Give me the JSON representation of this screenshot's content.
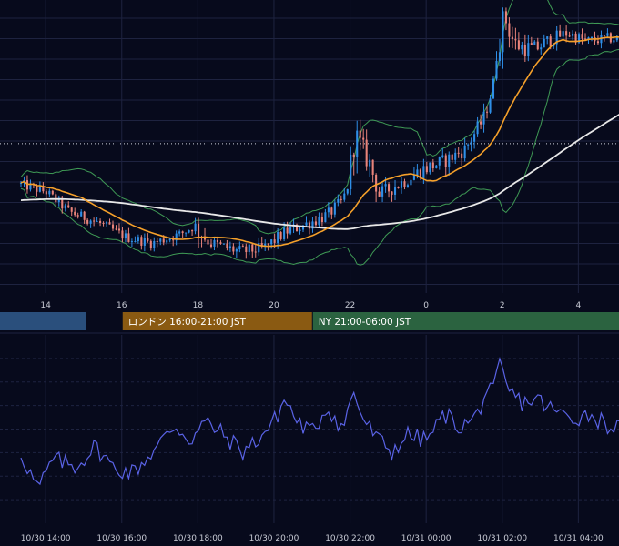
{
  "colors": {
    "background": "#070a1c",
    "grid": "#1e2340",
    "bull": "#2f8fe8",
    "bear": "#e8837a",
    "bollinger": "#3f9a55",
    "sma_short": "#f5a02a",
    "sma_long": "#e8e8e8",
    "rsi": "#5a63e6",
    "tokyo": "#2a4f7c",
    "london": "#8a5a12",
    "newyork": "#2b6340"
  },
  "sessions": [
    {
      "label": "",
      "start_h": 0,
      "end_h": 19.88
    },
    {
      "label": "ロンドン 16:00-21:00 JST",
      "start_h": 16,
      "end_h": 21
    },
    {
      "label": "NY 21:00-06:00 JST",
      "start_h": 21,
      "end_h": 31
    }
  ],
  "top_axis_ticks": [
    "14",
    "16",
    "18",
    "20",
    "22",
    "0",
    "2",
    "4"
  ],
  "bottom_axis_ticks": [
    "10/30 14:00",
    "10/30 16:00",
    "10/30 18:00",
    "10/30 20:00",
    "10/30 22:00",
    "10/31 00:00",
    "10/31 02:00",
    "10/31 04:00"
  ],
  "chart_data": [
    {
      "type": "candlestick",
      "x_start_h": 13.35,
      "x_end_h": 29.5,
      "interval_min": 5,
      "ylim": [
        0,
        100
      ],
      "x_ticks_h": [
        14,
        16,
        18,
        20,
        22,
        24,
        26,
        28
      ],
      "grid": true,
      "reference_level": 51,
      "anchors": [
        [
          13.35,
          37
        ],
        [
          14.1,
          34
        ],
        [
          14.7,
          27
        ],
        [
          15.5,
          23
        ],
        [
          16.2,
          18
        ],
        [
          16.9,
          16
        ],
        [
          17.6,
          19
        ],
        [
          18.0,
          22
        ],
        [
          18.4,
          16
        ],
        [
          19.2,
          13
        ],
        [
          19.8,
          14
        ],
        [
          20.4,
          20
        ],
        [
          21.0,
          23
        ],
        [
          21.5,
          26
        ],
        [
          21.9,
          31
        ],
        [
          22.05,
          38
        ],
        [
          22.2,
          54
        ],
        [
          22.6,
          44
        ],
        [
          22.85,
          33
        ],
        [
          23.4,
          37
        ],
        [
          24.0,
          42
        ],
        [
          24.6,
          45
        ],
        [
          25.1,
          49
        ],
        [
          25.6,
          60
        ],
        [
          25.85,
          72
        ],
        [
          25.95,
          85
        ],
        [
          26.15,
          96
        ],
        [
          26.4,
          86
        ],
        [
          26.9,
          84
        ],
        [
          27.4,
          88
        ],
        [
          27.8,
          90
        ],
        [
          28.3,
          87
        ],
        [
          28.8,
          88
        ],
        [
          29.2,
          88
        ],
        [
          29.5,
          89
        ]
      ],
      "volatility": [
        [
          13.35,
          4
        ],
        [
          17.9,
          4
        ],
        [
          18.0,
          9
        ],
        [
          18.3,
          5
        ],
        [
          21.9,
          5
        ],
        [
          22.05,
          14
        ],
        [
          22.3,
          10
        ],
        [
          22.9,
          6
        ],
        [
          25.8,
          6
        ],
        [
          25.95,
          13
        ],
        [
          26.4,
          8
        ],
        [
          27.5,
          5
        ],
        [
          29.5,
          4
        ]
      ],
      "series": [
        {
          "name": "",
          "kind": "candles"
        },
        {
          "name": "",
          "kind": "bollinger",
          "period": 20,
          "stddev": 2
        },
        {
          "name": "",
          "kind": "sma",
          "period": 20
        },
        {
          "name": "",
          "kind": "sma",
          "period": 96
        }
      ]
    },
    {
      "type": "line",
      "x_start_h": 13.35,
      "x_end_h": 29.5,
      "ylim": [
        0,
        100
      ],
      "gridlines": [
        12.5,
        25,
        37.5,
        50,
        62.5,
        75,
        87.5
      ],
      "x_ticks_h": [
        14,
        16,
        18,
        20,
        22,
        24,
        26,
        28
      ],
      "series": [
        {
          "name": "",
          "anchors": [
            [
              13.35,
              37
            ],
            [
              13.8,
              18
            ],
            [
              14.2,
              34
            ],
            [
              14.8,
              30
            ],
            [
              15.3,
              41
            ],
            [
              15.8,
              29
            ],
            [
              16.3,
              27
            ],
            [
              16.9,
              40
            ],
            [
              17.4,
              52
            ],
            [
              17.8,
              44
            ],
            [
              18.0,
              49
            ],
            [
              18.2,
              54
            ],
            [
              18.6,
              48
            ],
            [
              19.2,
              38
            ],
            [
              19.6,
              45
            ],
            [
              20.0,
              54
            ],
            [
              20.3,
              66
            ],
            [
              20.6,
              54
            ],
            [
              21.0,
              48
            ],
            [
              21.4,
              62
            ],
            [
              21.8,
              50
            ],
            [
              22.1,
              70
            ],
            [
              22.3,
              57
            ],
            [
              22.7,
              45
            ],
            [
              23.1,
              38
            ],
            [
              23.5,
              47
            ],
            [
              24.0,
              44
            ],
            [
              24.5,
              58
            ],
            [
              24.9,
              51
            ],
            [
              25.3,
              56
            ],
            [
              25.6,
              71
            ],
            [
              25.75,
              68
            ],
            [
              25.95,
              85
            ],
            [
              26.1,
              72
            ],
            [
              26.5,
              64
            ],
            [
              26.9,
              66
            ],
            [
              27.4,
              59
            ],
            [
              27.9,
              56
            ],
            [
              28.3,
              58
            ],
            [
              28.8,
              52
            ],
            [
              29.1,
              50
            ],
            [
              29.5,
              57
            ]
          ]
        }
      ]
    }
  ]
}
